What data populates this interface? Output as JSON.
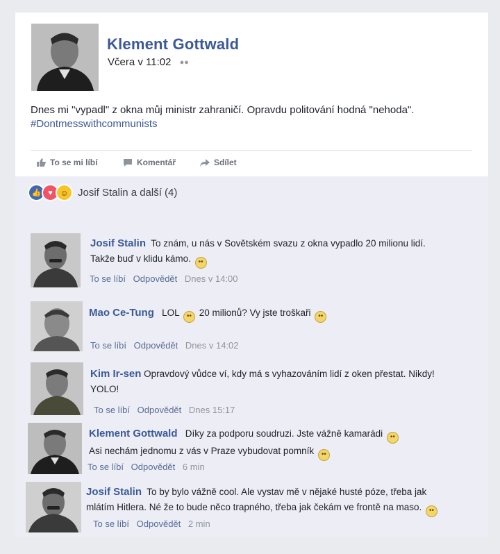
{
  "post": {
    "author": "Klement Gottwald",
    "time": "Včera v 11:02",
    "text": "Dnes mi \"vypadl\" z okna můj ministr zahraničí. Opravdu politování hodná \"nehoda\".",
    "hashtag": "#Dontmesswithcommunists",
    "actions": {
      "like": "To se mi líbí",
      "comment": "Komentář",
      "share": "Sdílet"
    },
    "reactions": {
      "summary": "Josif Stalin a další (4)",
      "types": [
        "like-icon",
        "love-icon",
        "haha-icon"
      ]
    }
  },
  "comments": [
    {
      "name": "Josif Stalin",
      "text1": "To znám, u nás v Sovětském svazu z okna vypadlo 20 milionu lidí.",
      "text2": "Takže buď v klidu kámo.",
      "like": "To se líbí",
      "reply": "Odpovědět",
      "time": "Dnes v 14:00"
    },
    {
      "name": "Mao Ce-Tung",
      "text1a": "LOL",
      "text1b": "20 milionů? Vy jste troškaři",
      "like": "To se líbí",
      "reply": "Odpovědět",
      "time": "Dnes v 14:02"
    },
    {
      "name": "Kim Ir-sen",
      "text1": "Opravdový vůdce ví, kdy má s vyhazováním lidí z oken přestat. Nikdy!",
      "text2": "YOLO!",
      "like": "To se líbí",
      "reply": "Odpovědět",
      "time": "Dnes 15:17"
    },
    {
      "name": "Klement Gottwald",
      "text1": "Díky za podporu soudruzi. Jste vážně kamarádi",
      "text2": "Asi nechám jednomu z vás v Praze vybudovat pomník",
      "like": "To se líbí",
      "reply": "Odpovědět",
      "time": "6 min"
    },
    {
      "name": "Josif Stalin",
      "text1": "To by bylo vážně cool. Ale vystav mě v nějaké husté póze, třeba jak",
      "text2": "mlátím Hitlera. Né že to bude něco trapného, třeba jak čekám ve frontě na maso.",
      "like": "To se líbí",
      "reply": "Odpovědět",
      "time": "2 min"
    }
  ],
  "colors": {
    "link": "#3b5998",
    "background": "#e9ebee",
    "comments_bg": "#edeef5"
  }
}
